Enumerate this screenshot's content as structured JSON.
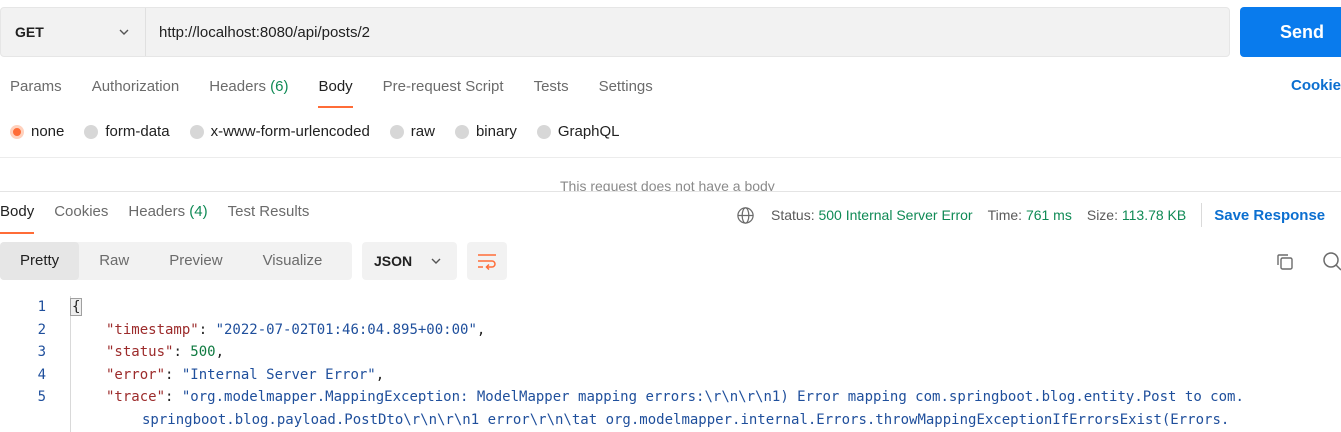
{
  "request": {
    "method": "GET",
    "url": "http://localhost:8080/api/posts/2",
    "send_label": "Send"
  },
  "request_tabs": [
    {
      "label": "Params",
      "count": ""
    },
    {
      "label": "Authorization",
      "count": ""
    },
    {
      "label": "Headers",
      "count": "(6)"
    },
    {
      "label": "Body",
      "count": ""
    },
    {
      "label": "Pre-request Script",
      "count": ""
    },
    {
      "label": "Tests",
      "count": ""
    },
    {
      "label": "Settings",
      "count": ""
    }
  ],
  "cookies_link": "Cookie",
  "body_types": [
    "none",
    "form-data",
    "x-www-form-urlencoded",
    "raw",
    "binary",
    "GraphQL"
  ],
  "no_body_message": "This request does not have a body",
  "response_tabs": [
    {
      "label": "Body",
      "count": ""
    },
    {
      "label": "Cookies",
      "count": ""
    },
    {
      "label": "Headers",
      "count": "(4)"
    },
    {
      "label": "Test Results",
      "count": ""
    }
  ],
  "response_meta": {
    "status_label": "Status:",
    "status_value": "500 Internal Server Error",
    "time_label": "Time:",
    "time_value": "761 ms",
    "size_label": "Size:",
    "size_value": "113.78 KB",
    "save_label": "Save Response"
  },
  "view_tabs": [
    "Pretty",
    "Raw",
    "Preview",
    "Visualize"
  ],
  "format": "JSON",
  "code": {
    "line_numbers": [
      "1",
      "2",
      "3",
      "4",
      "5"
    ],
    "open_brace": "{",
    "timestamp_key": "\"timestamp\"",
    "timestamp_value": "\"2022-07-02T01:46:04.895+00:00\"",
    "status_key": "\"status\"",
    "status_value": "500",
    "error_key": "\"error\"",
    "error_value": "\"Internal Server Error\"",
    "trace_key": "\"trace\"",
    "trace_value_line1": "\"org.modelmapper.MappingException: ModelMapper mapping errors:\\r\\n\\r\\n1) Error mapping com.springboot.blog.entity.Post to com.",
    "trace_value_line2": "springboot.blog.payload.PostDto\\r\\n\\r\\n1 error\\r\\n\\tat org.modelmapper.internal.Errors.throwMappingExceptionIfErrorsExist(Errors."
  }
}
